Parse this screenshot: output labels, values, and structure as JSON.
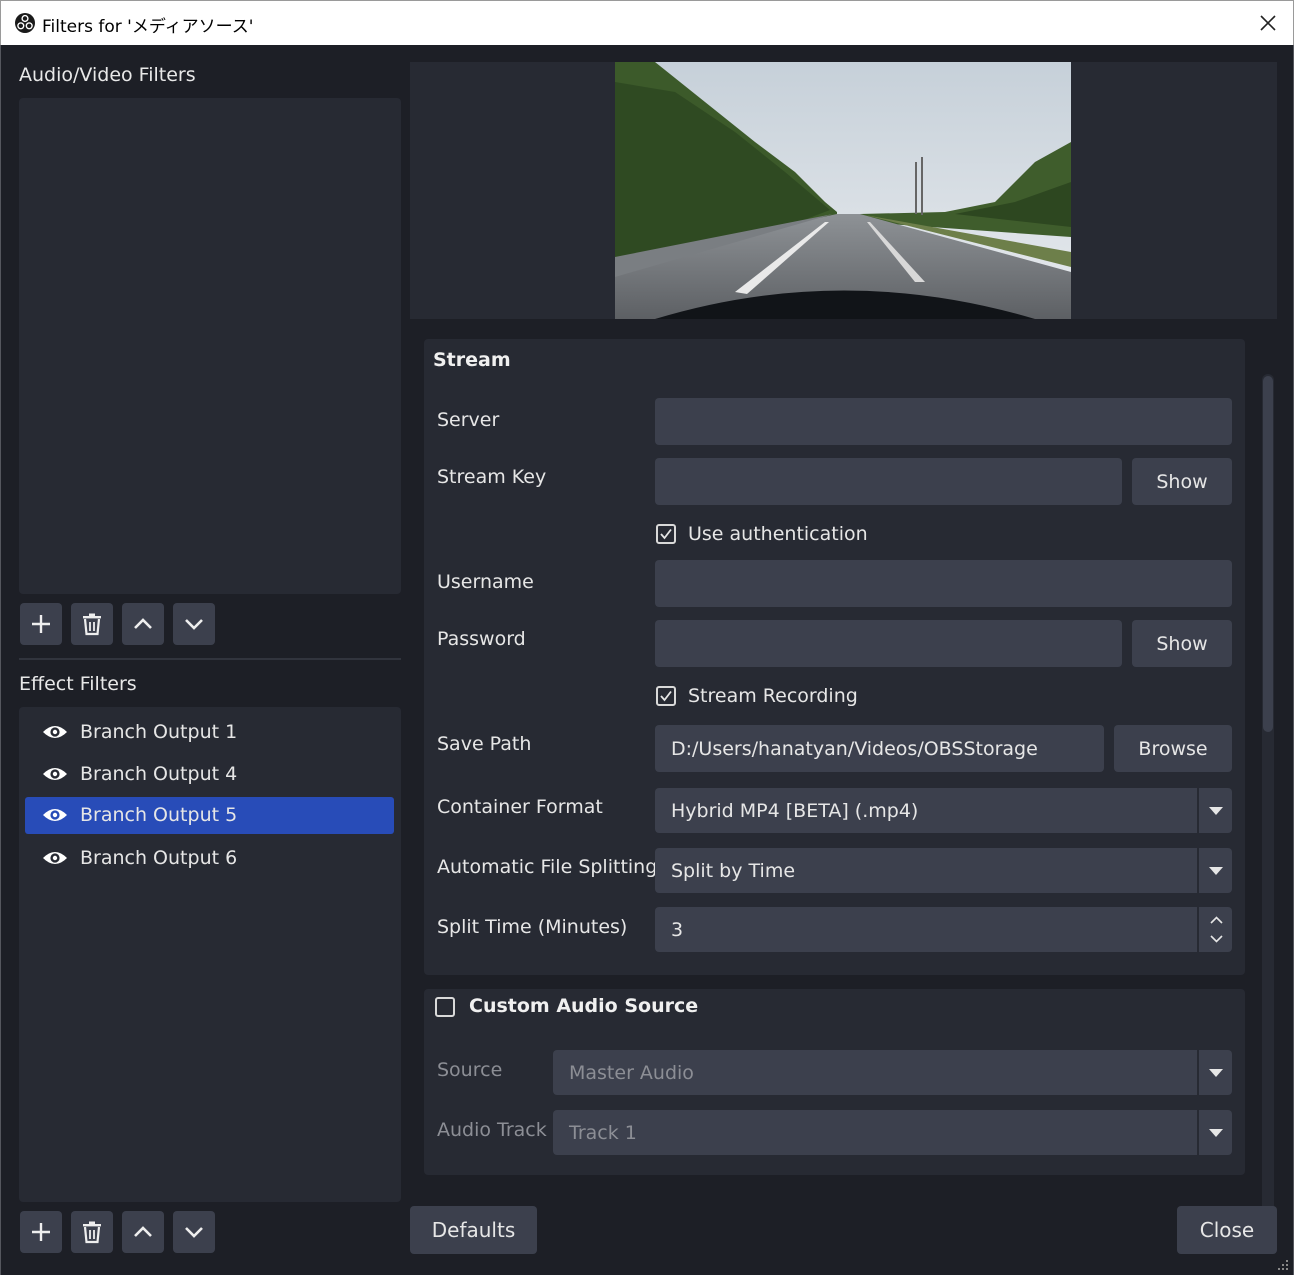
{
  "window": {
    "title": "Filters for 'メディアソース'"
  },
  "audio_video_filters": {
    "label": "Audio/Video Filters"
  },
  "effect_filters": {
    "label": "Effect Filters",
    "items": [
      {
        "label": "Branch Output 1",
        "selected": false
      },
      {
        "label": "Branch Output 4",
        "selected": false
      },
      {
        "label": "Branch Output 5",
        "selected": true
      },
      {
        "label": "Branch Output 6",
        "selected": false
      }
    ]
  },
  "stream_group": {
    "title": "Stream",
    "server_label": "Server",
    "server_value": "",
    "stream_key_label": "Stream Key",
    "stream_key_value": "",
    "show_label": "Show",
    "use_auth_label": "Use authentication",
    "use_auth_checked": true,
    "username_label": "Username",
    "username_value": "",
    "password_label": "Password",
    "password_value": "",
    "stream_recording_label": "Stream Recording",
    "stream_recording_checked": true,
    "save_path_label": "Save Path",
    "save_path_value": "D:/Users/hanatyan/Videos/OBSStorage",
    "browse_label": "Browse",
    "container_format_label": "Container Format",
    "container_format_value": "Hybrid MP4 [BETA] (.mp4)",
    "auto_split_label": "Automatic File Splitting",
    "auto_split_value": "Split by Time",
    "split_time_label": "Split Time (Minutes)",
    "split_time_value": "3"
  },
  "audio_group": {
    "title": "Custom Audio Source",
    "checked": false,
    "source_label": "Source",
    "source_value": "Master Audio",
    "track_label": "Audio Track",
    "track_value": "Track 1"
  },
  "footer": {
    "defaults_label": "Defaults",
    "close_label": "Close"
  },
  "colors": {
    "selection": "#284cb8",
    "panel": "#272a33",
    "control": "#3c404d",
    "background": "#1d1f26"
  }
}
